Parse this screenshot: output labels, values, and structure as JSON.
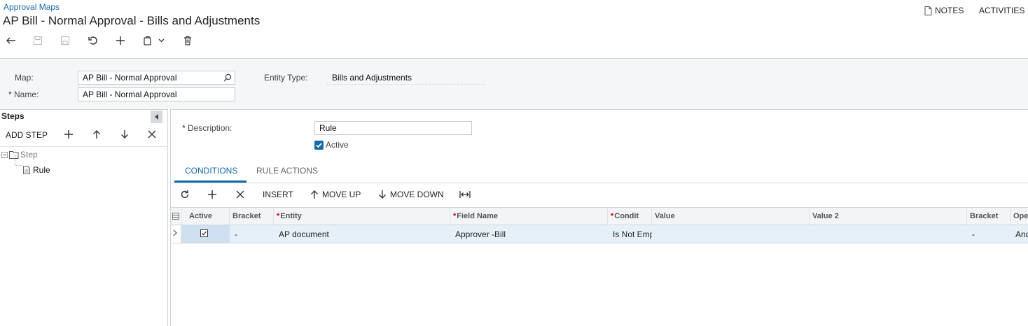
{
  "header": {
    "breadcrumb": "Approval Maps",
    "title": "AP Bill - Normal Approval - Bills and Adjustments",
    "notes_label": "NOTES",
    "activities_label": "ACTIVITIES"
  },
  "toolbar": {
    "icons": [
      "undo-icon",
      "save-close-icon",
      "save-icon",
      "cancel-icon",
      "add-icon",
      "copy-paste-icon",
      "chevron-down-icon",
      "delete-icon"
    ]
  },
  "form": {
    "map_label": "Map:",
    "map_value": "AP Bill - Normal Approval",
    "name_label": "Name:",
    "name_value": "AP Bill - Normal Approval",
    "entity_type_label": "Entity Type:",
    "entity_type_value": "Bills and Adjustments",
    "required_mark": "*"
  },
  "steps": {
    "title": "Steps",
    "add_step_label": "ADD STEP",
    "tree": {
      "step_label": "Step",
      "rule_label": "Rule"
    }
  },
  "rule": {
    "description_label": "Description:",
    "description_value": "Rule",
    "active_label": "Active",
    "active_checked": true
  },
  "tabs": {
    "conditions": "CONDITIONS",
    "rule_actions": "RULE ACTIONS"
  },
  "grid_toolbar": {
    "insert": "INSERT",
    "move_up": "MOVE UP",
    "move_down": "MOVE DOWN"
  },
  "grid": {
    "columns": {
      "active": "Active",
      "bracket": "Bracket",
      "entity": "Entity",
      "field_name": "Field Name",
      "condition": "Condit",
      "value": "Value",
      "value2": "Value 2",
      "bracket2": "Bracket",
      "operator": "Ope"
    },
    "rows": [
      {
        "active": true,
        "bracket": "-",
        "entity": "AP document",
        "field_name": "Approver -Bill",
        "condition": "Is Not Emp",
        "value": "",
        "value2": "",
        "bracket2": "-",
        "operator": "And"
      }
    ]
  },
  "colors": {
    "accent": "#1769aa",
    "required": "#cc0000",
    "selected_row": "#e6f0f8"
  }
}
